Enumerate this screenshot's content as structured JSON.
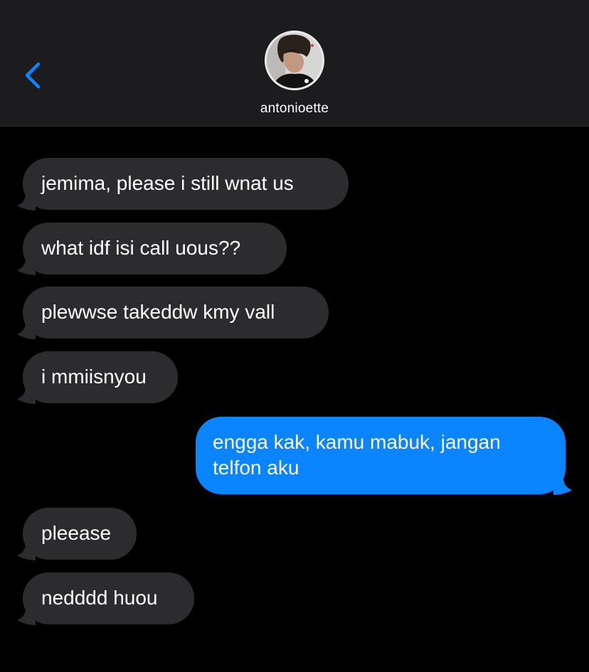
{
  "header": {
    "contact_name": "antonioette",
    "back_icon": "chevron-left-icon",
    "accent_color": "#0a84ff"
  },
  "messages": [
    {
      "direction": "incoming",
      "text": "jemima, please i still wnat us"
    },
    {
      "direction": "incoming",
      "text": "what idf isi call uous??"
    },
    {
      "direction": "incoming",
      "text": "plewwse takeddw kmy vall"
    },
    {
      "direction": "incoming",
      "text": "i mmiisnyou"
    },
    {
      "direction": "outgoing",
      "text": "engga kak, kamu mabuk, jangan telfon aku"
    },
    {
      "direction": "incoming",
      "text": "pleease"
    },
    {
      "direction": "incoming",
      "text": "nedddd huou"
    }
  ],
  "colors": {
    "incoming_bubble": "#2c2c2e",
    "outgoing_bubble": "#0a84ff",
    "header_background": "#1c1c1e",
    "thread_background": "#000000"
  }
}
